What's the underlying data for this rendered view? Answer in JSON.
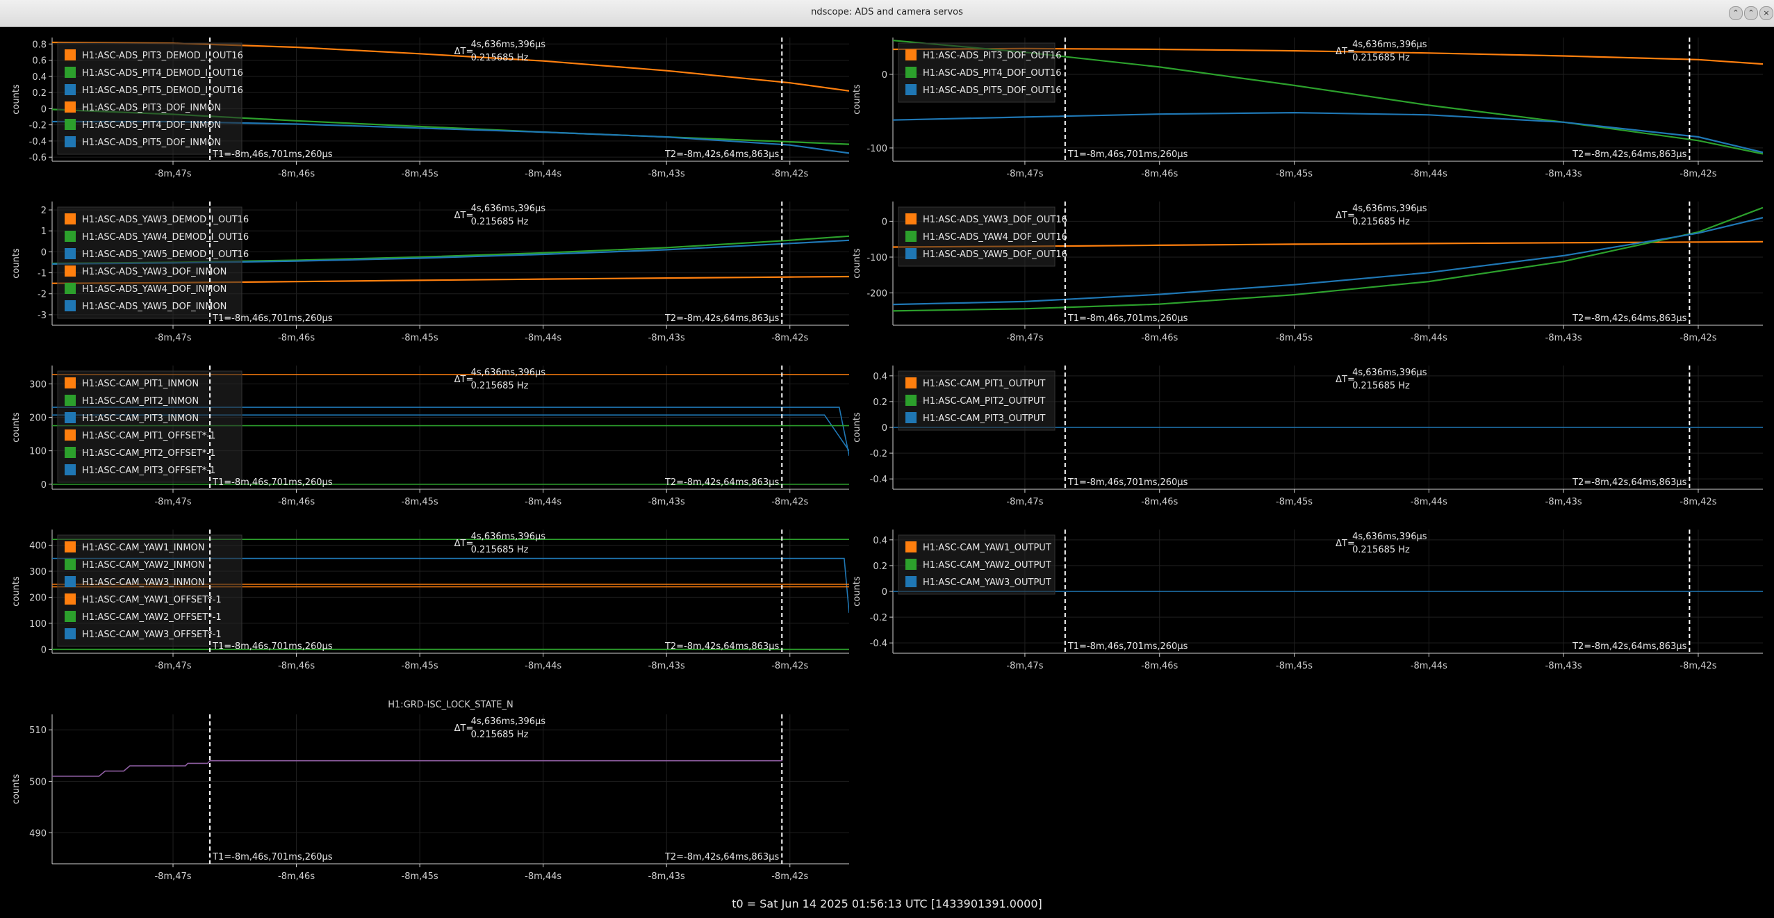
{
  "window": {
    "title": "ndscope: ADS and camera servos",
    "buttons": [
      "minimize-button",
      "maximize-button",
      "close-button"
    ]
  },
  "footer": {
    "t0": "t0 = Sat Jun 14 2025 01:56:13 UTC [1433901391.0000]"
  },
  "colors": {
    "orange": "#ff7f0e",
    "green": "#2ca02c",
    "blue": "#1f77b4",
    "purple": "#8e5ea2",
    "grid": "#1f1f1f",
    "axis": "#d0d0d0",
    "cursor": "#ffffff"
  },
  "cursors": {
    "t1_label": "T1=-8m,46s,701ms,260μs",
    "t2_label": "T2=-8m,42s,64ms,863μs",
    "delta_prefix": "ΔT=",
    "delta_value": "4s,636ms,396μs",
    "delta_freq": "0.215685 Hz",
    "t1": -466.70126,
    "t2": -462.064863
  },
  "time_axis": {
    "xlim": [
      -467.98,
      -461.52
    ],
    "ticks": [
      -467,
      -466,
      -465,
      -464,
      -463,
      -462
    ],
    "tick_labels": [
      "-8m,47s",
      "-8m,46s",
      "-8m,45s",
      "-8m,44s",
      "-8m,43s",
      "-8m,42s"
    ]
  },
  "chart_data": [
    {
      "type": "line",
      "title": "",
      "ylabel": "counts",
      "ylim": [
        -0.65,
        0.88
      ],
      "yticks": [
        -0.6,
        -0.4,
        -0.2,
        0,
        0.2,
        0.4,
        0.6,
        0.8
      ],
      "ytick_labels": [
        "-0.6",
        "-0.4",
        "-0.2",
        "0",
        "0.2",
        "0.4",
        "0.6",
        "0.8"
      ],
      "legend": [
        "H1:ASC-ADS_PIT3_DEMOD_I_OUT16",
        "H1:ASC-ADS_PIT4_DEMOD_I_OUT16",
        "H1:ASC-ADS_PIT5_DEMOD_I_OUT16",
        "H1:ASC-ADS_PIT3_DOF_INMON",
        "H1:ASC-ADS_PIT4_DOF_INMON",
        "H1:ASC-ADS_PIT5_DOF_INMON"
      ],
      "legend_colors": [
        "orange",
        "green",
        "blue",
        "orange",
        "green",
        "blue"
      ],
      "series": [
        {
          "color": "orange",
          "x": [
            -467.98,
            -467,
            -466,
            -465,
            -464,
            -463,
            -462,
            -461.52
          ],
          "y": [
            0.82,
            0.81,
            0.76,
            0.68,
            0.59,
            0.47,
            0.32,
            0.22
          ]
        },
        {
          "color": "green",
          "x": [
            -467.98,
            -467,
            -466,
            -465,
            -464,
            -463,
            -462,
            -461.52
          ],
          "y": [
            -0.01,
            -0.07,
            -0.15,
            -0.22,
            -0.29,
            -0.35,
            -0.41,
            -0.44
          ]
        },
        {
          "color": "blue",
          "x": [
            -467.98,
            -467,
            -466,
            -465,
            -464,
            -463,
            -462,
            -461.52
          ],
          "y": [
            -0.16,
            -0.16,
            -0.19,
            -0.24,
            -0.29,
            -0.35,
            -0.45,
            -0.55
          ]
        }
      ]
    },
    {
      "type": "line",
      "title": "",
      "ylabel": "counts",
      "ylim": [
        -118,
        50
      ],
      "yticks": [
        -100,
        0
      ],
      "ytick_labels": [
        "-100",
        "0"
      ],
      "legend": [
        "H1:ASC-ADS_PIT3_DOF_OUT16",
        "H1:ASC-ADS_PIT4_DOF_OUT16",
        "H1:ASC-ADS_PIT5_DOF_OUT16"
      ],
      "legend_colors": [
        "orange",
        "green",
        "blue"
      ],
      "series": [
        {
          "color": "orange",
          "x": [
            -467.98,
            -467,
            -466,
            -465,
            -464,
            -463,
            -462,
            -461.52
          ],
          "y": [
            34,
            35,
            34,
            32,
            29,
            25,
            20,
            14
          ]
        },
        {
          "color": "green",
          "x": [
            -467.98,
            -467,
            -466,
            -465,
            -464,
            -463,
            -462,
            -461.52
          ],
          "y": [
            46,
            30,
            10,
            -15,
            -42,
            -65,
            -90,
            -108
          ]
        },
        {
          "color": "blue",
          "x": [
            -467.98,
            -467,
            -466,
            -465,
            -464,
            -463,
            -462,
            -461.52
          ],
          "y": [
            -62,
            -58,
            -54,
            -52,
            -55,
            -65,
            -85,
            -106
          ]
        }
      ]
    },
    {
      "type": "line",
      "title": "",
      "ylabel": "counts",
      "ylim": [
        -3.5,
        2.4
      ],
      "yticks": [
        -3,
        -2,
        -1,
        0,
        1,
        2
      ],
      "ytick_labels": [
        "-3",
        "-2",
        "-1",
        "0",
        "1",
        "2"
      ],
      "legend": [
        "H1:ASC-ADS_YAW3_DEMOD_I_OUT16",
        "H1:ASC-ADS_YAW4_DEMOD_I_OUT16",
        "H1:ASC-ADS_YAW5_DEMOD_I_OUT16",
        "H1:ASC-ADS_YAW3_DOF_INMON",
        "H1:ASC-ADS_YAW4_DOF_INMON",
        "H1:ASC-ADS_YAW5_DOF_INMON"
      ],
      "legend_colors": [
        "orange",
        "green",
        "blue",
        "orange",
        "green",
        "blue"
      ],
      "series": [
        {
          "color": "orange",
          "x": [
            -467.98,
            -467,
            -466,
            -465,
            -464,
            -463,
            -462,
            -461.52
          ],
          "y": [
            -1.5,
            -1.47,
            -1.42,
            -1.36,
            -1.3,
            -1.25,
            -1.2,
            -1.18
          ]
        },
        {
          "color": "green",
          "x": [
            -467.98,
            -467,
            -466,
            -465,
            -464,
            -463,
            -462,
            -461.52
          ],
          "y": [
            -0.55,
            -0.5,
            -0.4,
            -0.25,
            -0.05,
            0.2,
            0.55,
            0.75
          ]
        },
        {
          "color": "blue",
          "x": [
            -467.98,
            -467,
            -466,
            -465,
            -464,
            -463,
            -462,
            -461.52
          ],
          "y": [
            -0.58,
            -0.53,
            -0.44,
            -0.3,
            -0.12,
            0.1,
            0.4,
            0.55
          ]
        }
      ]
    },
    {
      "type": "line",
      "title": "",
      "ylabel": "counts",
      "ylim": [
        -290,
        55
      ],
      "yticks": [
        -200,
        -100,
        0
      ],
      "ytick_labels": [
        "-200",
        "-100",
        "0"
      ],
      "legend": [
        "H1:ASC-ADS_YAW3_DOF_OUT16",
        "H1:ASC-ADS_YAW4_DOF_OUT16",
        "H1:ASC-ADS_YAW5_DOF_OUT16"
      ],
      "legend_colors": [
        "orange",
        "green",
        "blue"
      ],
      "series": [
        {
          "color": "orange",
          "x": [
            -467.98,
            -467,
            -466,
            -465,
            -464,
            -463,
            -462,
            -461.52
          ],
          "y": [
            -72,
            -70,
            -67,
            -64,
            -62,
            -60,
            -58,
            -57
          ]
        },
        {
          "color": "green",
          "x": [
            -467.98,
            -467,
            -466,
            -465,
            -464,
            -463,
            -462,
            -461.52
          ],
          "y": [
            -250,
            -244,
            -231,
            -205,
            -168,
            -112,
            -30,
            38
          ]
        },
        {
          "color": "blue",
          "x": [
            -467.98,
            -467,
            -466,
            -465,
            -464,
            -463,
            -462,
            -461.52
          ],
          "y": [
            -232,
            -224,
            -204,
            -177,
            -143,
            -96,
            -33,
            10
          ]
        }
      ]
    },
    {
      "type": "line",
      "title": "",
      "ylabel": "counts",
      "ylim": [
        -15,
        355
      ],
      "yticks": [
        0,
        100,
        200,
        300
      ],
      "ytick_labels": [
        "0",
        "100",
        "200",
        "300"
      ],
      "legend": [
        "H1:ASC-CAM_PIT1_INMON",
        "H1:ASC-CAM_PIT2_INMON",
        "H1:ASC-CAM_PIT3_INMON",
        "H1:ASC-CAM_PIT1_OFFSET*-1",
        "H1:ASC-CAM_PIT2_OFFSET*-1",
        "H1:ASC-CAM_PIT3_OFFSET*-1"
      ],
      "legend_colors": [
        "orange",
        "green",
        "blue",
        "orange",
        "green",
        "blue"
      ],
      "series": [
        {
          "color": "orange",
          "x": [
            -467.98,
            -461.52
          ],
          "y": [
            328,
            328
          ]
        },
        {
          "color": "blue",
          "x": [
            -467.98,
            -461.6,
            -461.52
          ],
          "y": [
            230,
            230,
            85
          ]
        },
        {
          "color": "blue",
          "x": [
            -467.98,
            -461.72,
            -461.52
          ],
          "y": [
            207,
            207,
            100
          ]
        },
        {
          "color": "green",
          "x": [
            -467.98,
            -461.52
          ],
          "y": [
            175,
            175
          ]
        },
        {
          "color": "green",
          "x": [
            -467.98,
            -461.52
          ],
          "y": [
            0,
            0
          ]
        }
      ]
    },
    {
      "type": "line",
      "title": "",
      "ylabel": "counts",
      "ylim": [
        -0.48,
        0.48
      ],
      "yticks": [
        -0.4,
        -0.2,
        0,
        0.2,
        0.4
      ],
      "ytick_labels": [
        "-0.4",
        "-0.2",
        "0",
        "0.2",
        "0.4"
      ],
      "legend": [
        "H1:ASC-CAM_PIT1_OUTPUT",
        "H1:ASC-CAM_PIT2_OUTPUT",
        "H1:ASC-CAM_PIT3_OUTPUT"
      ],
      "legend_colors": [
        "orange",
        "green",
        "blue"
      ],
      "series": [
        {
          "color": "blue",
          "x": [
            -467.98,
            -461.52
          ],
          "y": [
            0,
            0
          ]
        }
      ]
    },
    {
      "type": "line",
      "title": "",
      "ylabel": "counts",
      "ylim": [
        -15,
        460
      ],
      "yticks": [
        0,
        100,
        200,
        300,
        400
      ],
      "ytick_labels": [
        "0",
        "100",
        "200",
        "300",
        "400"
      ],
      "legend": [
        "H1:ASC-CAM_YAW1_INMON",
        "H1:ASC-CAM_YAW2_INMON",
        "H1:ASC-CAM_YAW3_INMON",
        "H1:ASC-CAM_YAW1_OFFSET*-1",
        "H1:ASC-CAM_YAW2_OFFSET*-1",
        "H1:ASC-CAM_YAW3_OFFSET*-1"
      ],
      "legend_colors": [
        "orange",
        "green",
        "blue",
        "orange",
        "green",
        "blue"
      ],
      "series": [
        {
          "color": "green",
          "x": [
            -467.98,
            -461.52
          ],
          "y": [
            422,
            422
          ]
        },
        {
          "color": "blue",
          "x": [
            -467.98,
            -461.56,
            -461.52
          ],
          "y": [
            349,
            349,
            140
          ]
        },
        {
          "color": "orange",
          "x": [
            -467.98,
            -461.52
          ],
          "y": [
            250,
            250
          ]
        },
        {
          "color": "orange",
          "x": [
            -467.98,
            -461.52
          ],
          "y": [
            240,
            240
          ]
        },
        {
          "color": "green",
          "x": [
            -467.98,
            -461.52
          ],
          "y": [
            0,
            0
          ]
        }
      ]
    },
    {
      "type": "line",
      "title": "",
      "ylabel": "counts",
      "ylim": [
        -0.48,
        0.48
      ],
      "yticks": [
        -0.4,
        -0.2,
        0,
        0.2,
        0.4
      ],
      "ytick_labels": [
        "-0.4",
        "-0.2",
        "0",
        "0.2",
        "0.4"
      ],
      "legend": [
        "H1:ASC-CAM_YAW1_OUTPUT",
        "H1:ASC-CAM_YAW2_OUTPUT",
        "H1:ASC-CAM_YAW3_OUTPUT"
      ],
      "legend_colors": [
        "orange",
        "green",
        "blue"
      ],
      "series": [
        {
          "color": "blue",
          "x": [
            -467.98,
            -461.52
          ],
          "y": [
            0,
            0
          ]
        }
      ]
    },
    {
      "type": "line",
      "title": "H1:GRD-ISC_LOCK_STATE_N",
      "ylabel": "counts",
      "ylim": [
        484,
        513
      ],
      "yticks": [
        490,
        500,
        510
      ],
      "ytick_labels": [
        "490",
        "500",
        "510"
      ],
      "legend": [],
      "legend_colors": [],
      "series": [
        {
          "color": "purple",
          "x": [
            -467.98,
            -467.6,
            -467.55,
            -467.4,
            -467.35,
            -466.9,
            -466.88,
            -466.72,
            -466.7,
            -462.06
          ],
          "y": [
            501,
            501,
            502,
            502,
            503,
            503,
            503.5,
            503.5,
            504,
            504
          ]
        }
      ]
    }
  ]
}
